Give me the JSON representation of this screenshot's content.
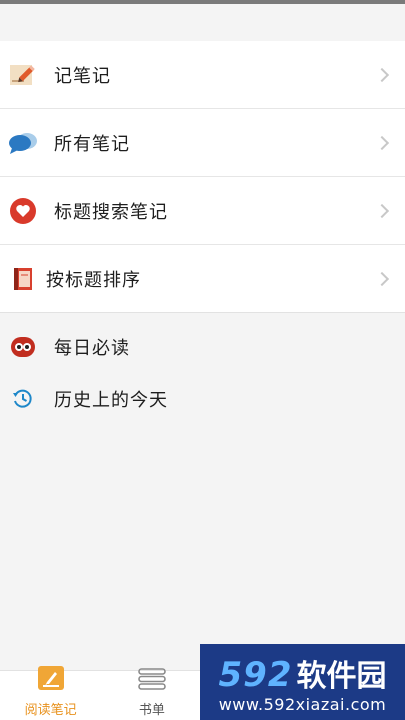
{
  "menu": [
    {
      "label": "记笔记",
      "icon": "pencil-note-icon"
    },
    {
      "label": "所有笔记",
      "icon": "chat-bubbles-icon"
    },
    {
      "label": "标题搜索笔记",
      "icon": "heart-icon"
    },
    {
      "label": "按标题排序",
      "icon": "book-icon"
    }
  ],
  "extras": [
    {
      "label": "每日必读",
      "icon": "glasses-icon"
    },
    {
      "label": "历史上的今天",
      "icon": "history-icon"
    }
  ],
  "nav": [
    {
      "label": "阅读笔记",
      "icon": "pencil-square-icon",
      "active": true
    },
    {
      "label": "书单",
      "icon": "list-icon",
      "active": false
    }
  ],
  "watermark": {
    "brand_num": "592",
    "brand_cn": "软件园",
    "url": "www.592xiazai.com"
  },
  "colors": {
    "accent": "#e8921e",
    "watermark_bg": "#1c3a86"
  }
}
